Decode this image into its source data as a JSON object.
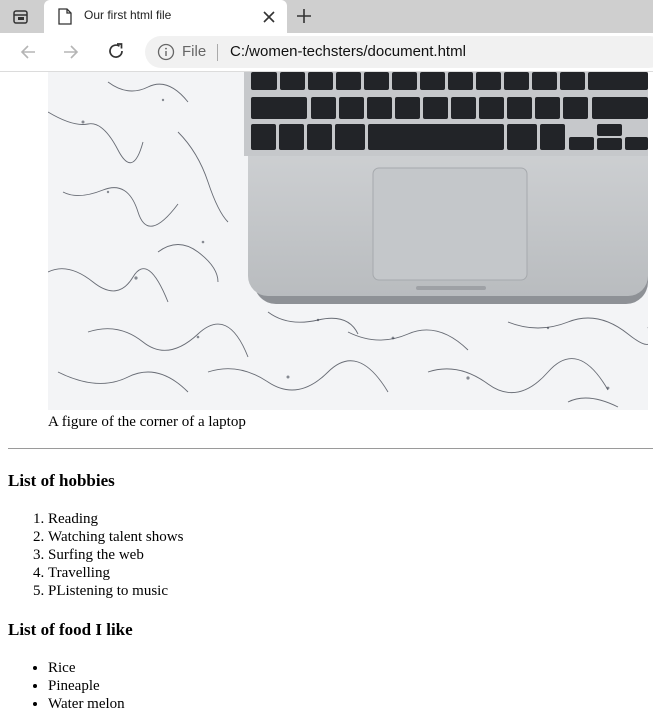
{
  "browser": {
    "tab_title": "Our first html file",
    "address_scheme_label": "File",
    "url": "C:/women-techsters/document.html",
    "icons": [
      "tab-actions-icon",
      "document-icon",
      "close-icon",
      "plus-icon",
      "back-arrow-icon",
      "forward-arrow-icon",
      "reload-icon",
      "info-icon"
    ]
  },
  "page": {
    "figure_caption": "A figure of the corner of a laptop",
    "hobbies": {
      "heading": "List of hobbies",
      "items": [
        "Reading",
        "Watching talent shows",
        "Surfing the web",
        "Travelling",
        "PListening to music"
      ]
    },
    "food": {
      "heading": "List of food I like",
      "items": [
        "Rice",
        "Pineaple",
        "Water melon"
      ]
    }
  }
}
